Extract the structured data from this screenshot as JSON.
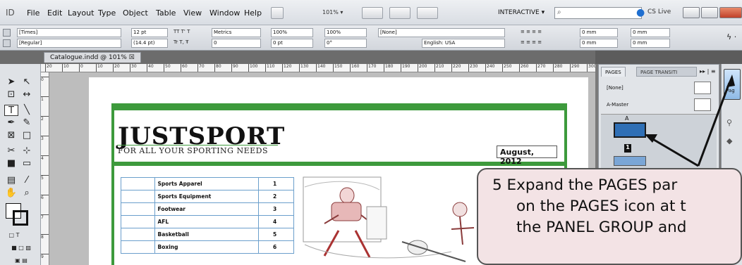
{
  "menubar": {
    "app_id": "ID",
    "menus": [
      "File",
      "Edit",
      "Layout",
      "Type",
      "Object",
      "Table",
      "View",
      "Window",
      "Help"
    ],
    "zoom": "101%",
    "workspace": "INTERACTIVE",
    "cslive": "CS Live"
  },
  "control": {
    "font_family": "[Times]",
    "font_style": "[Regular]",
    "font_size": "12 pt",
    "leading": "(14.4 pt)",
    "kerning": "Metrics",
    "tracking": "0",
    "vscale": "100%",
    "hscale": "100%",
    "baseline": "0 pt",
    "skew": "0°",
    "char_style": "[None]",
    "language": "English: USA",
    "indent1": "0 mm",
    "indent2": "0 mm",
    "indent3": "0 mm",
    "indent4": "0 mm"
  },
  "doc_tab": "Catalogue.indd @ 101%",
  "ruler_ticks": [
    "20",
    "10",
    "0",
    "10",
    "20",
    "30",
    "40",
    "50",
    "60",
    "70",
    "80",
    "90",
    "100",
    "110",
    "120",
    "130",
    "140",
    "150",
    "160",
    "170",
    "180",
    "190",
    "200",
    "210",
    "220",
    "230",
    "240",
    "250",
    "260",
    "270",
    "280",
    "290",
    "300"
  ],
  "vruler_ticks": [
    "0",
    "1",
    "2",
    "3",
    "4",
    "5",
    "6",
    "7",
    "8",
    "9"
  ],
  "document": {
    "logo": "JUSTSPORT",
    "tagline": "FOR ALL YOUR SPORTING NEEDS",
    "date": "August, 2012",
    "contents": [
      {
        "category": "Sports Apparel",
        "page": "1"
      },
      {
        "category": "Sports Equipment",
        "page": "2"
      },
      {
        "category": "Footwear",
        "page": "3"
      },
      {
        "category": "AFL",
        "page": "4"
      },
      {
        "category": "Basketball",
        "page": "5"
      },
      {
        "category": "Boxing",
        "page": "6"
      }
    ]
  },
  "panel": {
    "tab_pages": "PAGES",
    "tab_transitions": "PAGE TRANSITI",
    "none_master": "[None]",
    "a_master": "A-Master",
    "page_number": "1",
    "thumb_label": "A",
    "icon_label_pages": "Pag",
    "icon_label_links": "Lin"
  },
  "callout": {
    "lines": [
      "5  Expand the PAGES par",
      "on the PAGES icon at t",
      "the PANEL GROUP and"
    ]
  }
}
